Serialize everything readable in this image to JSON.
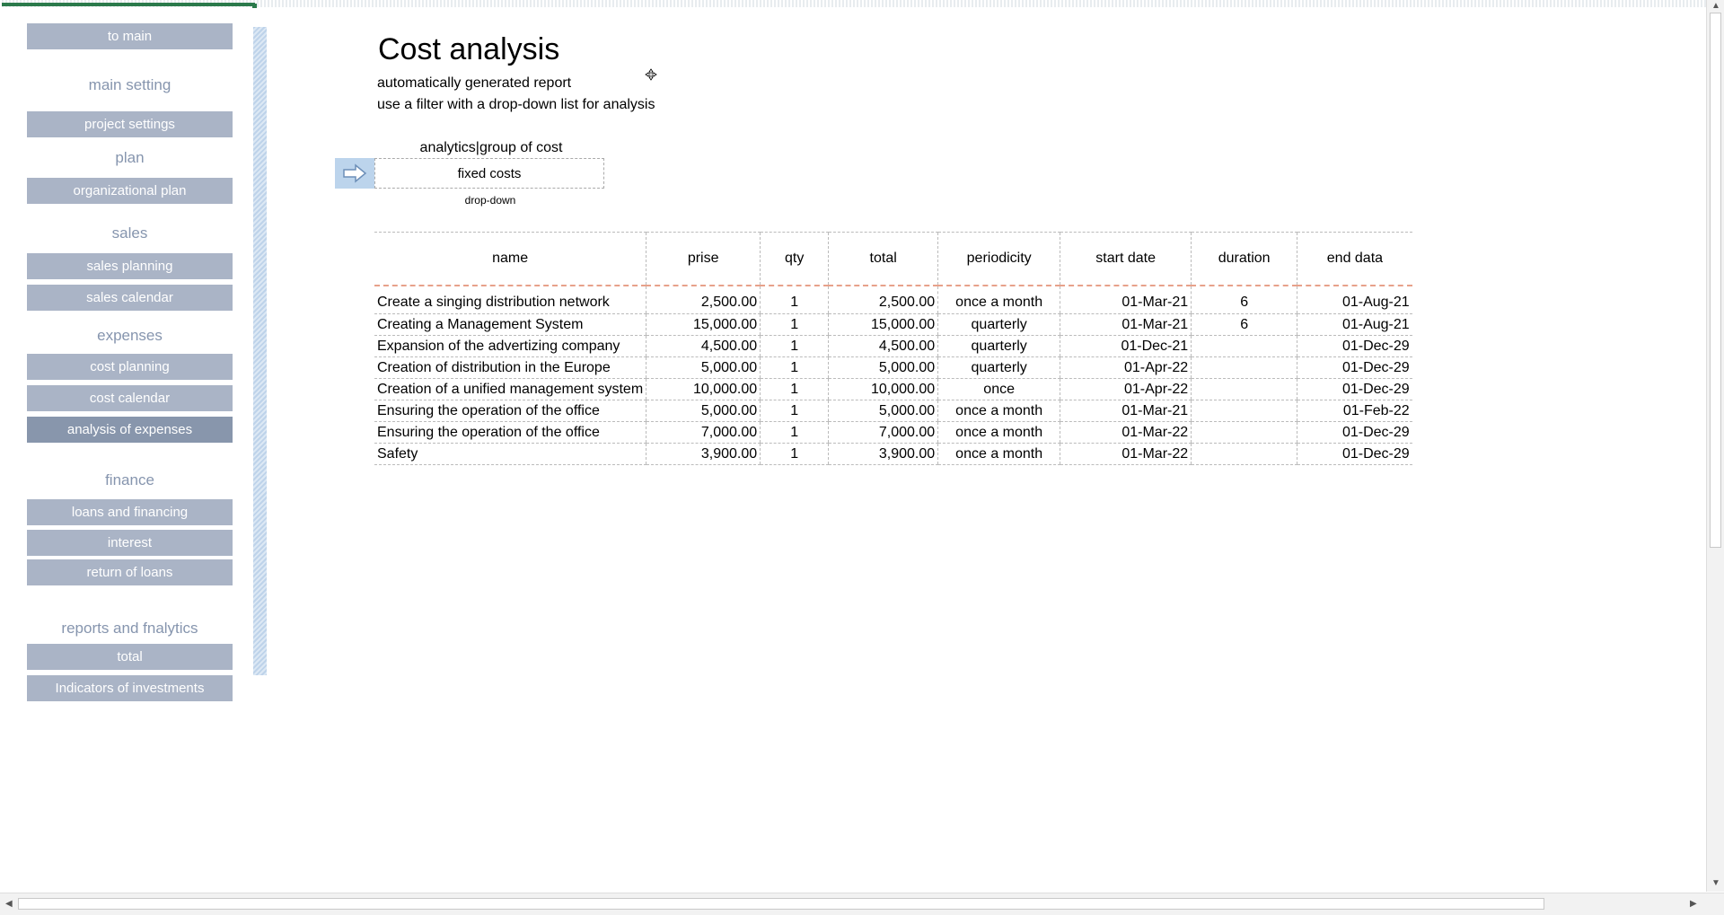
{
  "nav": {
    "to_main": "to main",
    "main_setting": "main setting",
    "project_settings": "project settings",
    "plan": "plan",
    "organizational_plan": "organizational plan",
    "sales": "sales",
    "sales_planning": "sales planning",
    "sales_calendar": "sales calendar",
    "expenses": "expenses",
    "cost_planning": "cost planning",
    "cost_calendar": "cost calendar",
    "analysis_of_expenses": "analysis of expenses",
    "finance": "finance",
    "loans_and_financing": "loans and financing",
    "interest": "interest",
    "return_of_loans": "return of loans",
    "reports": "reports and fnalytics",
    "total": "total",
    "indicators": "Indicators of investments"
  },
  "page": {
    "title": "Cost analysis",
    "subtitle1": "automatically generated report",
    "subtitle2": "use a filter with a drop-down list for analysis"
  },
  "filter": {
    "label": "analytics|group of cost",
    "value": "fixed costs",
    "hint": "drop-down"
  },
  "table": {
    "headers": [
      "name",
      "prise",
      "qty",
      "total",
      "periodicity",
      "start date",
      "duration",
      "end data"
    ],
    "rows": [
      [
        "Create a singing distribution network",
        "2,500.00",
        "1",
        "2,500.00",
        "once a month",
        "01-Mar-21",
        "6",
        "01-Aug-21"
      ],
      [
        "Creating a Management System",
        "15,000.00",
        "1",
        "15,000.00",
        "quarterly",
        "01-Mar-21",
        "6",
        "01-Aug-21"
      ],
      [
        "Expansion of the advertizing company",
        "4,500.00",
        "1",
        "4,500.00",
        "quarterly",
        "01-Dec-21",
        "",
        "01-Dec-29"
      ],
      [
        "Creation of distribution in the Europe",
        "5,000.00",
        "1",
        "5,000.00",
        "quarterly",
        "01-Apr-22",
        "",
        "01-Dec-29"
      ],
      [
        "Creation of a unified management system",
        "10,000.00",
        "1",
        "10,000.00",
        "once",
        "01-Apr-22",
        "",
        "01-Dec-29"
      ],
      [
        "Ensuring the operation of the office",
        "5,000.00",
        "1",
        "5,000.00",
        "once a month",
        "01-Mar-21",
        "",
        "01-Feb-22"
      ],
      [
        "Ensuring the operation of the office",
        "7,000.00",
        "1",
        "7,000.00",
        "once a month",
        "01-Mar-22",
        "",
        "01-Dec-29"
      ],
      [
        "Safety",
        "3,900.00",
        "1",
        "3,900.00",
        "once a month",
        "01-Mar-22",
        "",
        "01-Dec-29"
      ]
    ]
  },
  "colors": {
    "nav_button": "#aab4c6",
    "nav_button_active": "#8896ac",
    "nav_heading": "#8695ae",
    "hatch": "#bed3ea"
  }
}
